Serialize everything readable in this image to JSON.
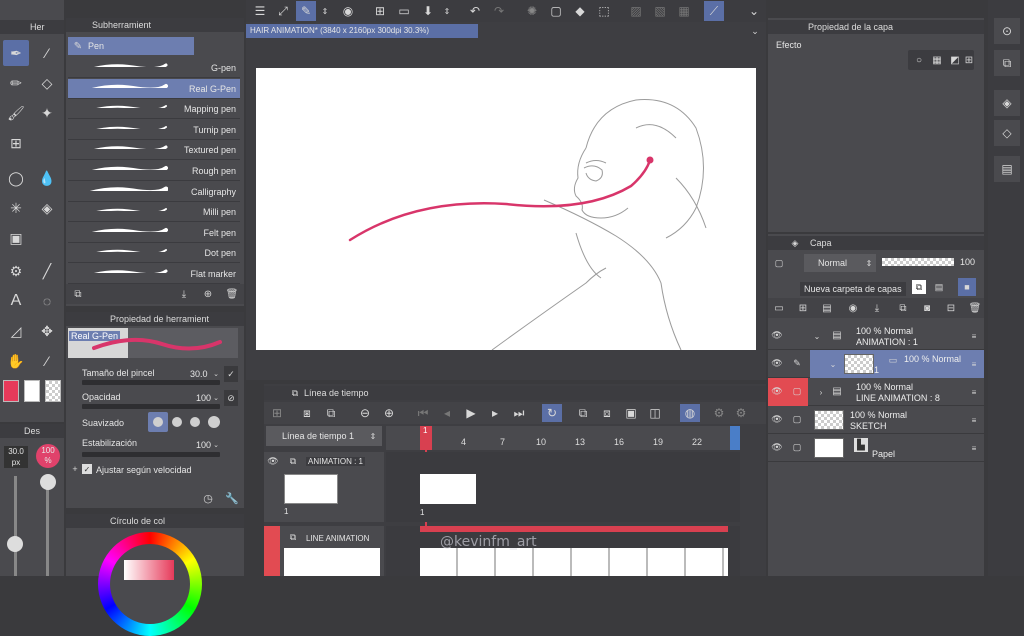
{
  "top_toolbar": {
    "icons": [
      "menu-icon",
      "transform-icon",
      "pen-icon",
      "chevron-updown-icon",
      "preview-icon",
      "new-file-icon",
      "open-file-icon",
      "save-icon",
      "chevron-updown-icon",
      "undo-icon",
      "redo-icon",
      "loading-icon",
      "clear-icon",
      "fill-icon",
      "transform-icon",
      "chevron-down-icon"
    ]
  },
  "left_tool_panel": {
    "tab_label": "Her"
  },
  "subtool_panel": {
    "header": "Subherramient",
    "group_label": "Pen",
    "brushes": [
      "G-pen",
      "Real G-Pen",
      "Mapping pen",
      "Turnip pen",
      "Textured pen",
      "Rough pen",
      "Calligraphy",
      "Milli pen",
      "Felt pen",
      "Dot pen",
      "Flat marker"
    ],
    "selected_index": 1
  },
  "tool_property": {
    "header": "Propiedad de herramient",
    "preview_label": "Real G-Pen",
    "brush_size_label": "Tamaño del pincel",
    "brush_size_value": "30.0",
    "opacity_label": "Opacidad",
    "opacity_value": "100",
    "smoothing_label": "Suavizado",
    "stabilization_label": "Estabilización",
    "stabilization_value": "100",
    "speed_label": "Ajustar según velocidad"
  },
  "brush_size_panel": {
    "header": "Des",
    "size_value": "30.0",
    "size_unit": "px",
    "opacity_value": "100",
    "opacity_unit": "%"
  },
  "color_panel": {
    "header": "Círculo de col"
  },
  "canvas": {
    "tab_title": "HAIR ANIMATION* (3840 x 2160px 300dpi 30.3%)",
    "stroke_color": "#d8356a"
  },
  "timeline": {
    "header": "Línea de tiempo",
    "selector": "Línea de tiempo 1",
    "current_frame": "1",
    "frame_numbers": [
      "4",
      "7",
      "10",
      "13",
      "16",
      "19",
      "22"
    ],
    "tracks": [
      {
        "name": "ANIMATION : 1",
        "cel": "1"
      },
      {
        "name": "LINE ANIMATION"
      }
    ],
    "watermark": "@kevinfm_art"
  },
  "layer_property": {
    "header": "Propiedad de la capa",
    "effect_label": "Efecto"
  },
  "layer_panel": {
    "header": "Capa",
    "blend_mode": "Normal",
    "opacity": "100",
    "new_folder_tooltip": "Nueva carpeta de capas",
    "layers": [
      {
        "line1": "100 % Normal",
        "line2": "ANIMATION : 1"
      },
      {
        "line1": "100 % Normal",
        "line2": "1"
      },
      {
        "line1": "100 % Normal",
        "line2": "LINE ANIMATION : 8"
      },
      {
        "line1": "100 % Normal",
        "line2": "SKETCH"
      },
      {
        "line1": "Papel",
        "line2": ""
      }
    ]
  }
}
